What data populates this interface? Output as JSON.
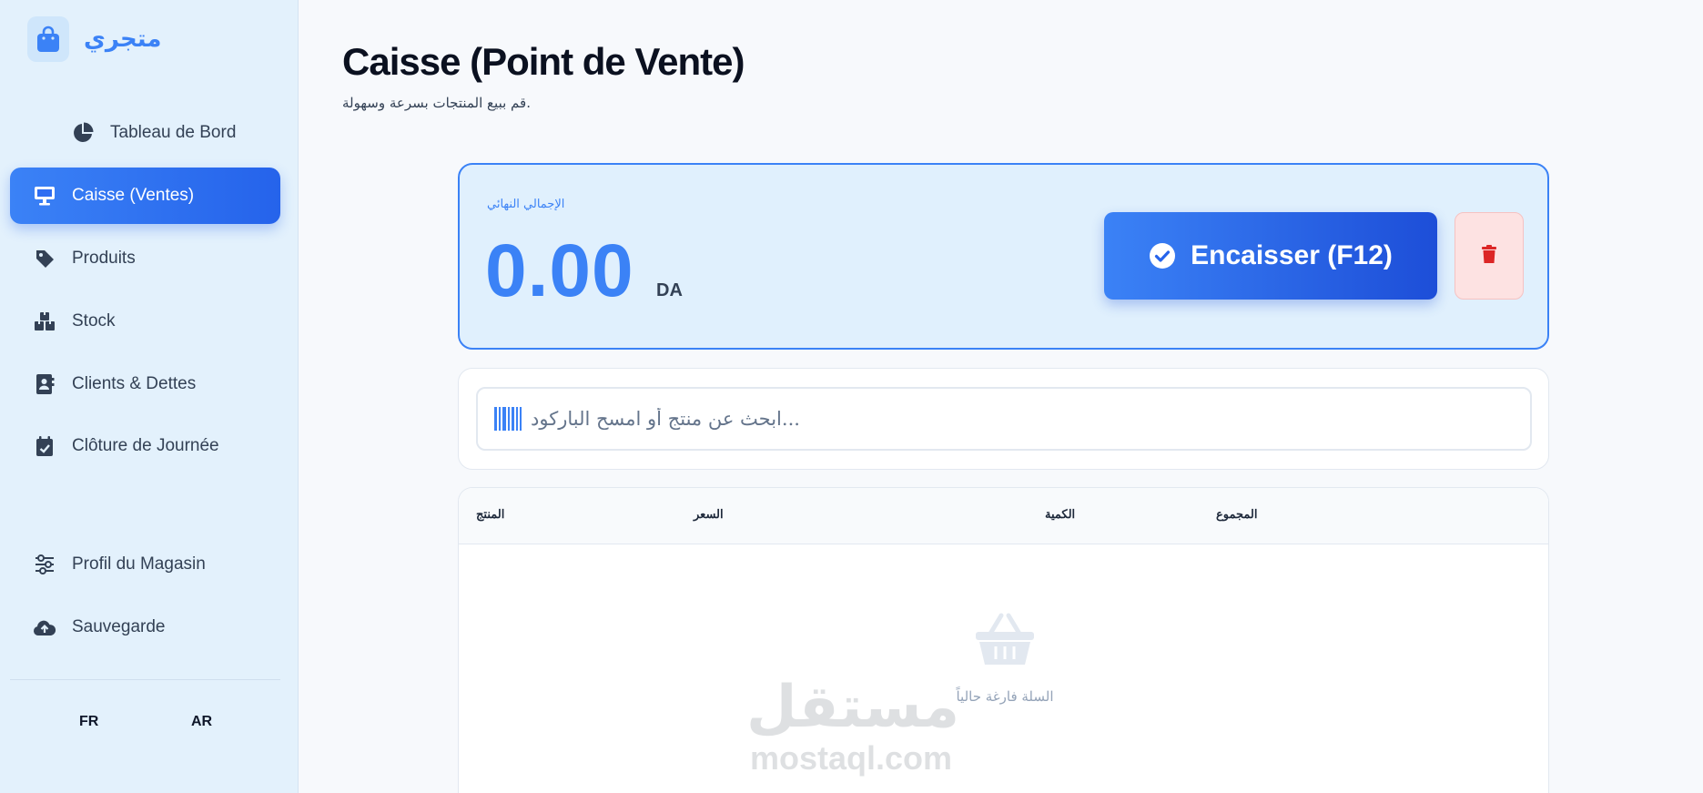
{
  "brand": {
    "name": "متجري"
  },
  "sidebar": {
    "items": [
      {
        "label": "Tableau de Bord",
        "icon": "pie-chart-icon"
      },
      {
        "label": "Caisse (Ventes)",
        "icon": "monitor-icon",
        "active": true
      },
      {
        "label": "Produits",
        "icon": "tag-icon"
      },
      {
        "label": "Stock",
        "icon": "boxes-icon"
      },
      {
        "label": "Clients & Dettes",
        "icon": "contact-book-icon"
      },
      {
        "label": "Clôture de Journée",
        "icon": "calendar-check-icon"
      }
    ],
    "bottom_items": [
      {
        "label": "Profil du Magasin",
        "icon": "sliders-icon"
      },
      {
        "label": "Sauvegarde",
        "icon": "cloud-upload-icon"
      }
    ],
    "languages": [
      "FR",
      "AR"
    ]
  },
  "header": {
    "title": "Caisse (Point de Vente)",
    "subtitle": "قم ببيع المنتجات بسرعة وسهولة."
  },
  "total": {
    "label": "الإجمالي النهائي",
    "amount": "0.00",
    "currency": "DA",
    "checkout_label": "Encaisser (F12)"
  },
  "search": {
    "placeholder": "ابحث عن منتج أو امسح الباركود..."
  },
  "cart": {
    "columns": [
      "المنتج",
      "السعر",
      "الكمية",
      "المجموع"
    ],
    "empty_text": "السلة فارغة حالياً"
  },
  "watermark": {
    "arabic": "مستقل",
    "latin": "mostaql.com"
  },
  "colors": {
    "accent": "#3b82f6",
    "accent_dark": "#1d4ed8",
    "sidebar_bg": "#e3f1fc",
    "danger": "#dc2626"
  }
}
